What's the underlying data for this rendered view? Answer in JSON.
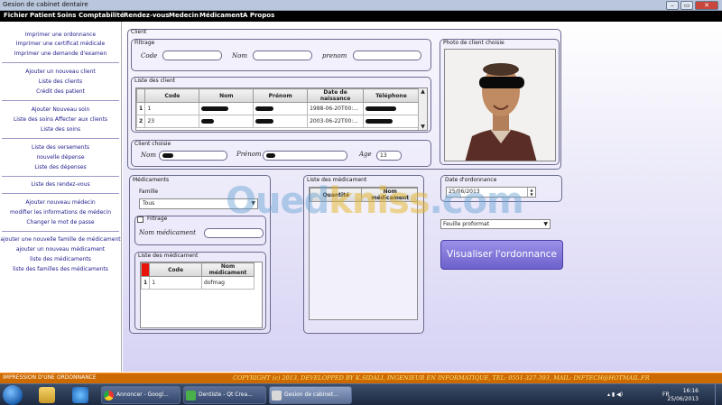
{
  "window": {
    "title": "Gesion de cabinet dentaire",
    "controls": [
      "–",
      "▭",
      "✕"
    ]
  },
  "menubar": [
    "Fichier",
    "Patient",
    "Soins",
    "Comptabilité",
    "Rendez-vous",
    "Medecin",
    "Médicament",
    "A Propos"
  ],
  "sidebar": {
    "group1": [
      "Imprimer une ordonnance",
      "Imprimer une certificat médicale",
      "Imprimer une demande d'examen"
    ],
    "group2": [
      "Ajouter un nouveau client",
      "Liste des clients",
      "Crédit des patient"
    ],
    "group3": [
      "Ajouter Nouveau soin",
      "Liste des soins Affecter aux clients",
      "Liste des soins"
    ],
    "group4": [
      "Liste des versements",
      "nouvelle dépense",
      "Liste des dépenses"
    ],
    "group5": [
      "Liste des rendez-vous"
    ],
    "group6": [
      "Ajouter nouveau médecin",
      "modifier les informations de médecin",
      "Changer le mot de passe"
    ],
    "group7": [
      "ajouter une nouvelle famille de médicament",
      "ajouter un nouveau médicament",
      "liste des médicaments",
      "liste des familles des médicaments"
    ]
  },
  "client": {
    "title": "Client",
    "filtrage": {
      "title": "Filtrage",
      "code_label": "Code",
      "nom_label": "Nom",
      "prenom_label": "prenom"
    },
    "liste": {
      "title": "Liste des client",
      "headers": [
        "Code",
        "Nom",
        "Prénom",
        "Date de naissance",
        "Téléphone"
      ],
      "rows": [
        {
          "num": "1",
          "code": "1",
          "date": "1988-06-20T00:..."
        },
        {
          "num": "2",
          "code": "23",
          "date": "2003-06-22T00:..."
        }
      ]
    },
    "choisi": {
      "title": "Client choisie",
      "nom_label": "Nom",
      "prenom_label": "Prénom",
      "age_label": "Age",
      "age_value": "13"
    },
    "photo_title": "Photo de client choisie"
  },
  "medicaments": {
    "title": "Médicaments",
    "famille_label": "Famille",
    "famille_value": "Tous",
    "filtrage_label": "Filtrage",
    "nom_label": "Nom médicament",
    "liste": {
      "title": "Liste des médicament",
      "headers": [
        "Code",
        "Nom médicament"
      ],
      "rows": [
        {
          "num": "1",
          "code": "1",
          "nom": "dofmag"
        }
      ]
    }
  },
  "ordonnance_list": {
    "title": "Liste des médicament",
    "headers": [
      "Quantité",
      "Nom médicament"
    ]
  },
  "date": {
    "title": "Date d'ordonnance",
    "value": "25/06/2013"
  },
  "format_select": "Feuille proformat",
  "visualiser_button": "Visualiser l'ordonnance",
  "statusbar": {
    "left": "IMPRESSION D'UNE ORDONNANCE",
    "right": "COPYRIGHT (c) 2013, DEVELOPPED BY K.SIDALI, INGENIEUR EN INFORMATIQUE, TEL: 0551-327-393, MAIL: INFTECH@HOTMAIL.FR"
  },
  "watermark": [
    "Oued",
    "kniss",
    ".com"
  ],
  "taskbar": {
    "items": [
      "Annoncer - Googl...",
      "Dentiste - Qt Crea...",
      "Gesion de cabinet..."
    ],
    "time": "16:16",
    "date": "25/06/2013",
    "lang": "FR"
  },
  "colors": {
    "menubar": "#000000",
    "statusbar": "#cc6a00",
    "button": "#7b6fd6",
    "sidebar_text": "#1e1a8a"
  }
}
